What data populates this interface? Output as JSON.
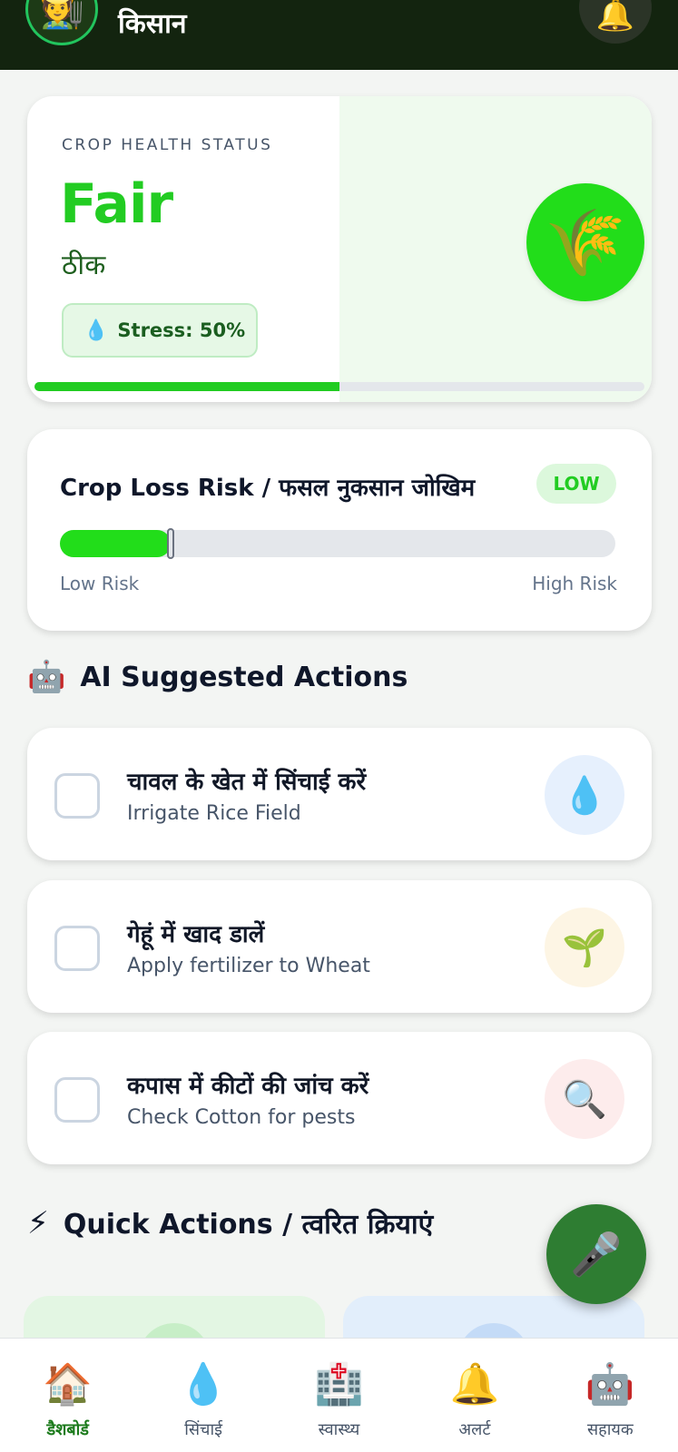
{
  "header": {
    "avatar_icon": "farmer-emoji",
    "avatar_glyph": "🧑‍🌾",
    "title": "किसान",
    "bell_icon": "bell-icon",
    "bell_glyph": "🔔"
  },
  "crop_health": {
    "label": "CROP HEALTH STATUS",
    "value": "Fair",
    "value_hindi": "ठीक",
    "stress_icon": "droplet-icon",
    "stress_glyph": "💧",
    "stress_text": "Stress: 50%",
    "crop_icon": "rice-icon",
    "crop_glyph": "🌾",
    "progress_fraction": 0.5,
    "accent_color": "#22cc22"
  },
  "risk": {
    "title": "Crop Loss Risk / फसल नुकसान जोखिम",
    "badge": "LOW",
    "level_fraction": 0.2,
    "low_label": "Low Risk",
    "high_label": "High Risk"
  },
  "ai_section": {
    "icon": "robot-icon",
    "glyph": "🤖",
    "title": "AI Suggested Actions"
  },
  "tasks": [
    {
      "hindi": "चावल के खेत में सिंचाई करें",
      "english": "Irrigate Rice Field",
      "icon": "droplet-icon",
      "glyph": "💧",
      "icon_bg": "#e6f0fd"
    },
    {
      "hindi": "गेहूं में खाद डालें",
      "english": "Apply fertilizer to Wheat",
      "icon": "seedling-icon",
      "glyph": "🌱",
      "icon_bg": "#fdf5e4"
    },
    {
      "hindi": "कपास में कीटों की जांच करें",
      "english": "Check Cotton for pests",
      "icon": "magnifier-icon",
      "glyph": "🔍",
      "icon_bg": "#fdecec"
    }
  ],
  "quick_section": {
    "icon": "lightning-icon",
    "glyph": "⚡",
    "title": "Quick Actions / त्वरित क्रियाएं"
  },
  "fab": {
    "icon": "microphone-icon",
    "glyph": "🎤"
  },
  "nav": [
    {
      "label": "डैशबोर्ड",
      "icon": "house-icon",
      "glyph": "🏠",
      "active": true
    },
    {
      "label": "सिंचाई",
      "icon": "droplet-icon",
      "glyph": "💧",
      "active": false
    },
    {
      "label": "स्वास्थ्य",
      "icon": "hospital-icon",
      "glyph": "🏥",
      "active": false
    },
    {
      "label": "अलर्ट",
      "icon": "bell-icon",
      "glyph": "🔔",
      "active": false
    },
    {
      "label": "सहायक",
      "icon": "robot-icon",
      "glyph": "🤖",
      "active": false
    }
  ]
}
